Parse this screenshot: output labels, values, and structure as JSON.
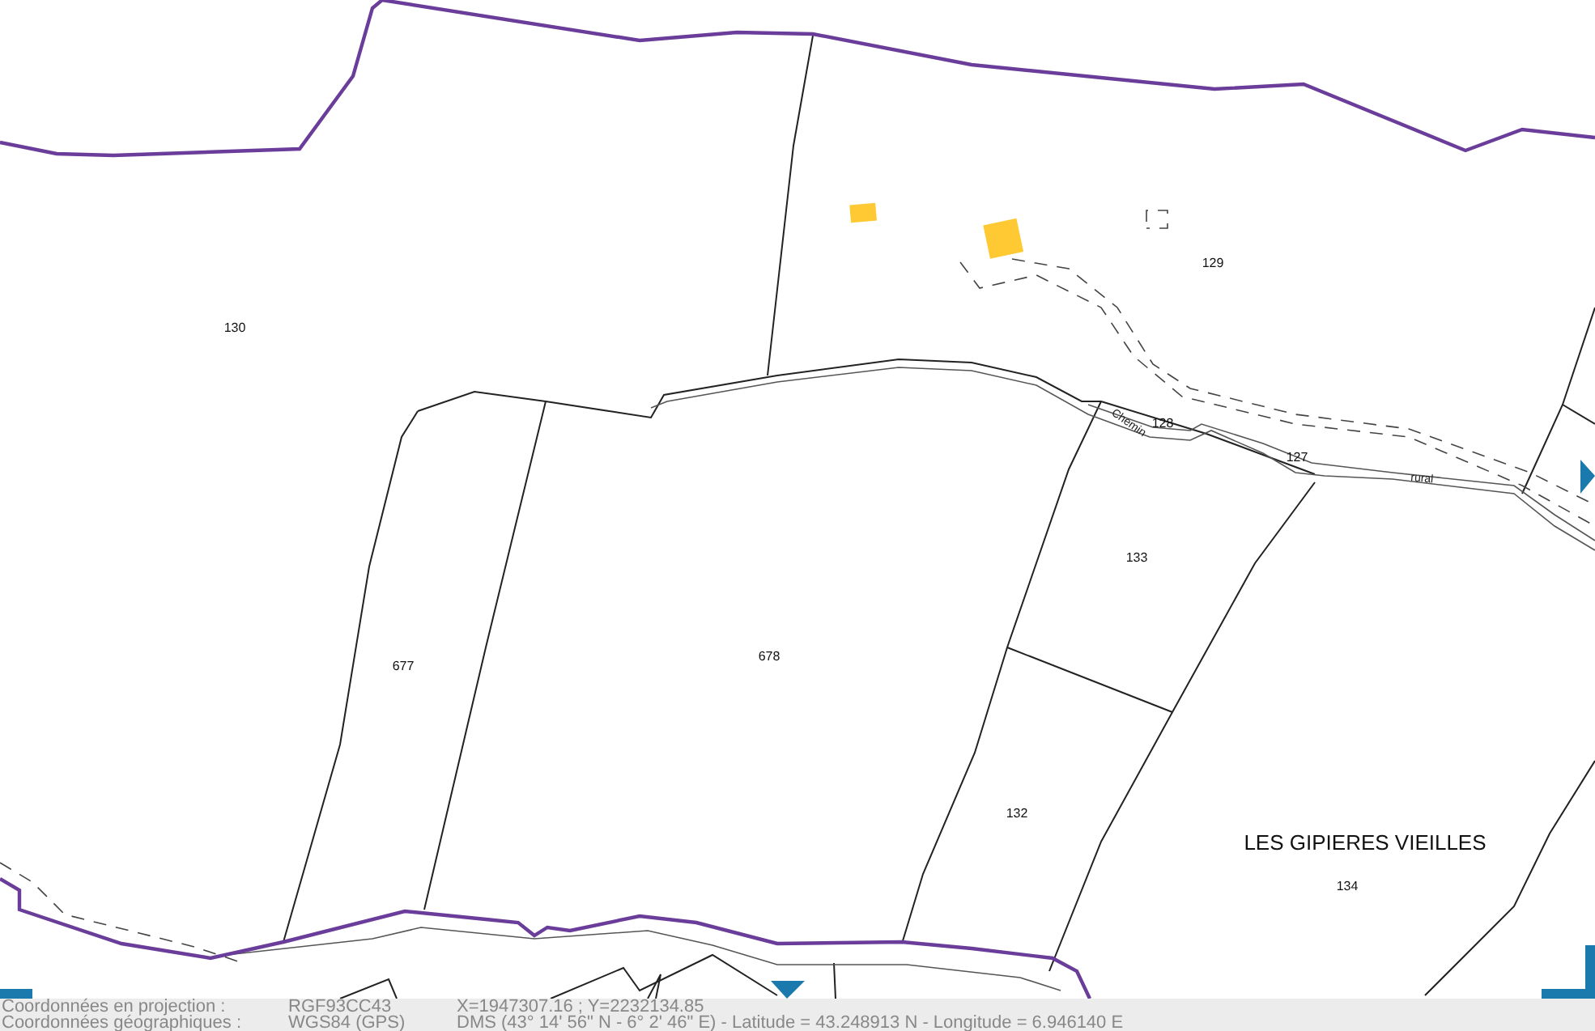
{
  "map": {
    "parcels": [
      "130",
      "129",
      "128",
      "127",
      "133",
      "677",
      "678",
      "132",
      "134"
    ],
    "locality": "LES GIPIERES VIEILLES",
    "road_labels": [
      "Chemin",
      "rural"
    ]
  },
  "status_bar": {
    "rows": [
      {
        "label": "Coordonnées en projection :",
        "system": "RGF93CC43",
        "value": "X=1947307.16 ; Y=2232134.85"
      },
      {
        "label": "Coordonnées géographiques :",
        "system": "WGS84 (GPS)",
        "value": "DMS (43° 14' 56\" N - 6° 2' 46\" E) - Latitude = 43.248913 N - Longitude = 6.946140 E"
      }
    ]
  }
}
